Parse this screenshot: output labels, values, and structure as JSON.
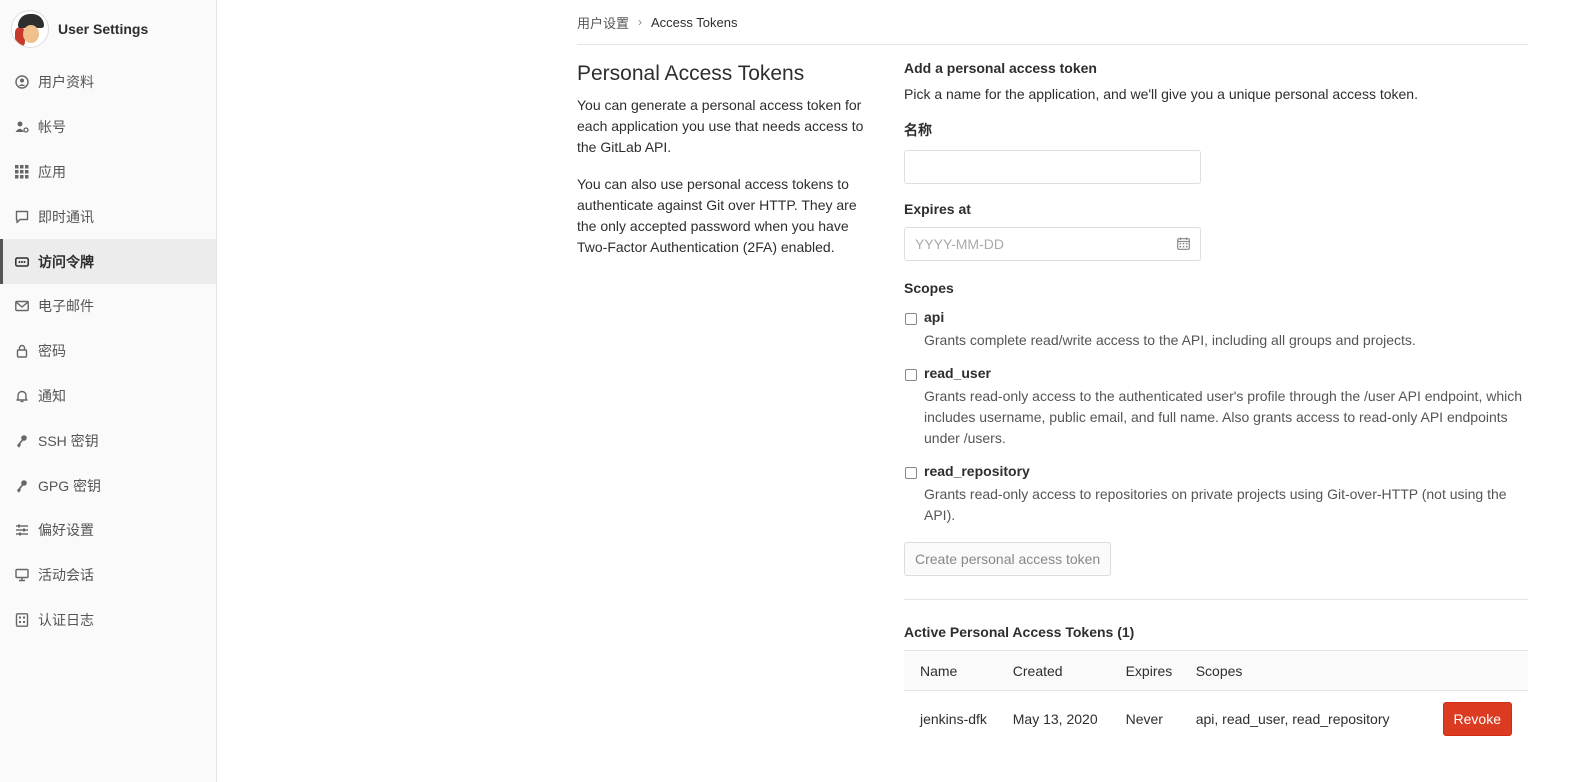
{
  "sidebar": {
    "title": "User Settings",
    "items": [
      {
        "label": "用户资料",
        "icon": "profile-icon",
        "active": false
      },
      {
        "label": "帐号",
        "icon": "account-icon",
        "active": false
      },
      {
        "label": "应用",
        "icon": "applications-icon",
        "active": false
      },
      {
        "label": "即时通讯",
        "icon": "chat-icon",
        "active": false
      },
      {
        "label": "访问令牌",
        "icon": "token-icon",
        "active": true
      },
      {
        "label": "电子邮件",
        "icon": "mail-icon",
        "active": false
      },
      {
        "label": "密码",
        "icon": "lock-icon",
        "active": false
      },
      {
        "label": "通知",
        "icon": "bell-icon",
        "active": false
      },
      {
        "label": "SSH 密钥",
        "icon": "key-icon",
        "active": false
      },
      {
        "label": "GPG 密钥",
        "icon": "key-icon",
        "active": false
      },
      {
        "label": "偏好设置",
        "icon": "preferences-icon",
        "active": false
      },
      {
        "label": "活动会话",
        "icon": "monitor-icon",
        "active": false
      },
      {
        "label": "认证日志",
        "icon": "log-icon",
        "active": false
      }
    ]
  },
  "breadcrumb": {
    "parent": "用户设置",
    "current": "Access Tokens"
  },
  "intro": {
    "title": "Personal Access Tokens",
    "paragraph1": "You can generate a personal access token for each application you use that needs access to the GitLab API.",
    "paragraph2": "You can also use personal access tokens to authenticate against Git over HTTP. They are the only accepted password when you have Two-Factor Authentication (2FA) enabled."
  },
  "form": {
    "title": "Add a personal access token",
    "description": "Pick a name for the application, and we'll give you a unique personal access token.",
    "name_label": "名称",
    "name_value": "",
    "expires_label": "Expires at",
    "expires_placeholder": "YYYY-MM-DD",
    "scopes_label": "Scopes",
    "scopes": [
      {
        "name": "api",
        "description": "Grants complete read/write access to the API, including all groups and projects.",
        "checked": false
      },
      {
        "name": "read_user",
        "description": "Grants read-only access to the authenticated user's profile through the /user API endpoint, which includes username, public email, and full name. Also grants access to read-only API endpoints under /users.",
        "checked": false
      },
      {
        "name": "read_repository",
        "description": "Grants read-only access to repositories on private projects using Git-over-HTTP (not using the API).",
        "checked": false
      }
    ],
    "submit_label": "Create personal access token"
  },
  "active_tokens": {
    "title": "Active Personal Access Tokens (1)",
    "columns": [
      "Name",
      "Created",
      "Expires",
      "Scopes"
    ],
    "rows": [
      {
        "name": "jenkins-dfk",
        "created": "May 13, 2020",
        "expires": "Never",
        "scopes": "api, read_user, read_repository",
        "action": "Revoke"
      }
    ]
  },
  "colors": {
    "revoke": "#db3b21",
    "sidebar_bg": "#fafafa",
    "active_item_bg": "#ececec"
  }
}
